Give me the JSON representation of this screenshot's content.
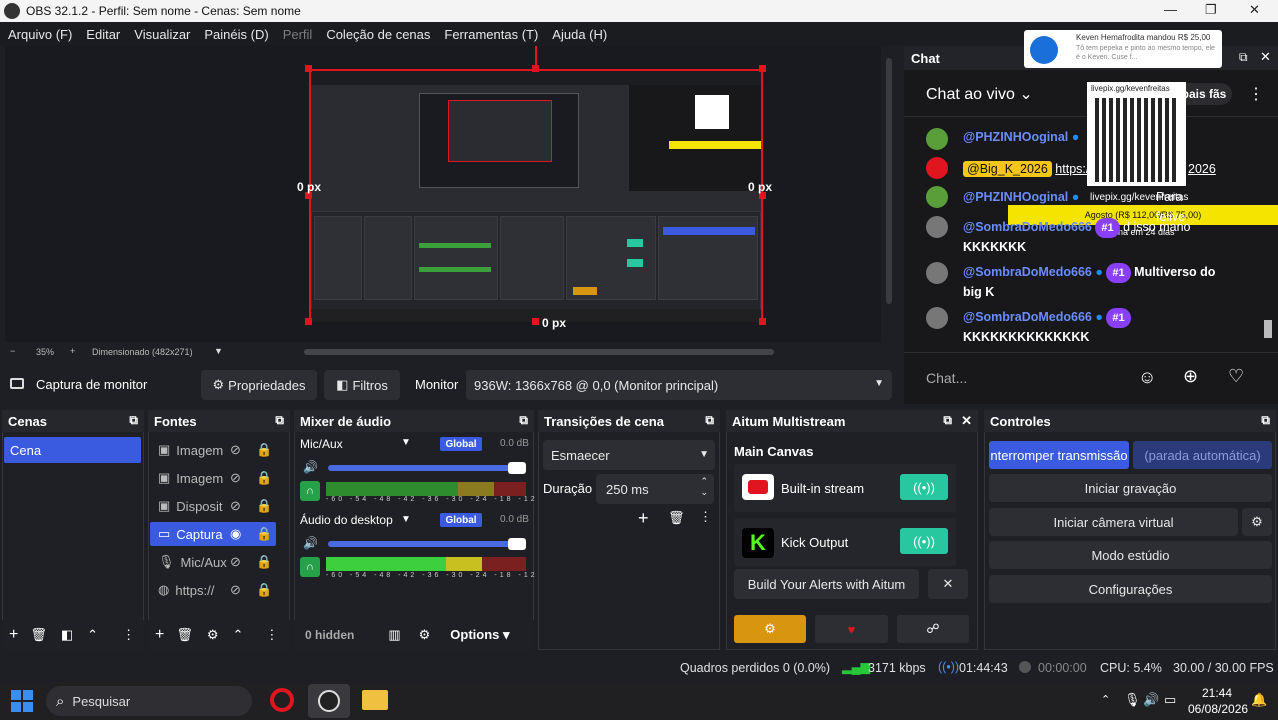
{
  "window": {
    "title": "OBS 32.1.2 - Perfil: Sem nome - Cenas: Sem nome",
    "minimize": "—",
    "maximize": "❐",
    "close": "✕"
  },
  "menu": [
    {
      "label": "Arquivo (F)"
    },
    {
      "label": "Editar"
    },
    {
      "label": "Visualizar"
    },
    {
      "label": "Painéis (D)"
    },
    {
      "label": "Perfil",
      "disabled": true
    },
    {
      "label": "Coleção de cenas"
    },
    {
      "label": "Ferramentas (T)"
    },
    {
      "label": "Ajuda (H)"
    }
  ],
  "preview": {
    "left_px": "0 px",
    "right_px": "0 px",
    "bottom_px": "0 px",
    "zoom_minus": "−",
    "zoom": "35%",
    "zoom_plus": "+",
    "scale_label": "Dimensionado (482x271)"
  },
  "source_toolbar": {
    "source_name": "Captura de monitor",
    "properties": "Propriedades",
    "filters": "Filtros",
    "monitor_label": "Monitor",
    "monitor_value": "936W: 1366x768 @ 0,0 (Monitor principal)"
  },
  "chat": {
    "title": "Chat",
    "live_label": "Chat ao vivo",
    "fans_label": "pais fãs",
    "input_placeholder": "Chat...",
    "donation": {
      "name": "Keven Hemafrodita",
      "action": "mandou",
      "amount": "R$ 25,00",
      "text": "Tô tem pepeka e pinto ao mesmo tempo, ele é o Keven. Cuse f..."
    },
    "livepix_url": "livepix.gg/kevenfreitas",
    "livepix_overlay": "livepix.gg/kevenfreitas",
    "goal": "Agosto (R$ 112,00/R$ 75,00)",
    "goal_end": "Termina em 24 dias",
    "messages": [
      {
        "user": "@PHZINHOoginal",
        "text": ""
      },
      {
        "user": "@Big_K_2026",
        "text": "https://",
        "extra": "2026",
        "highlight": true
      },
      {
        "user": "@PHZINHOoginal",
        "text": "Para felive"
      },
      {
        "user": "@SombraDoMedo666",
        "badge": "#1",
        "text": "d isso mano",
        "text2": "KKKKKKK"
      },
      {
        "user": "@SombraDoMedo666",
        "badge": "#1",
        "text": "Multiverso do",
        "text2": "big K"
      },
      {
        "user": "@SombraDoMedo666",
        "badge": "#1",
        "text": "",
        "text2": "KKKKKKKKKKKKKK"
      }
    ]
  },
  "docks": {
    "scenes": {
      "title": "Cenas",
      "items": [
        "Cena"
      ]
    },
    "sources": {
      "title": "Fontes",
      "items": [
        "Imagem",
        "Imagem",
        "Disposit",
        "Captura",
        "Mic/Aux",
        "https://"
      ]
    },
    "mixer": {
      "title": "Mixer de áudio",
      "tracks": [
        {
          "name": "Mic/Aux",
          "bus": "Global",
          "db": "0.0 dB"
        },
        {
          "name": "Áudio do desktop",
          "bus": "Global",
          "db": "0.0 dB"
        }
      ],
      "scale": "-60 -54 -48 -42 -36 -30 -24 -18 -12 -6 0",
      "hidden": "0 hidden",
      "options": "Options"
    },
    "transitions": {
      "title": "Transições de cena",
      "type": "Esmaecer",
      "duration_label": "Duração",
      "duration": "250 ms"
    },
    "multistream": {
      "title": "Aitum Multistream",
      "canvas": "Main Canvas",
      "outputs": [
        "Built-in stream",
        "Kick Output"
      ],
      "alerts": "Build Your Alerts with Aitum"
    },
    "controls": {
      "title": "Controles",
      "stop_stream": "nterromper transmissão",
      "auto_stop": "(parada automática)",
      "record": "Iniciar gravação",
      "virtual_cam": "Iniciar câmera virtual",
      "studio": "Modo estúdio",
      "settings": "Configurações"
    }
  },
  "status": {
    "dropped": "Quadros perdidos 0 (0.0%)",
    "bitrate": "3171 kbps",
    "stream_time": "01:44:43",
    "rec_time": "00:00:00",
    "cpu": "CPU: 5.4%",
    "fps": "30.00 / 30.00 FPS"
  },
  "taskbar": {
    "search": "Pesquisar",
    "time": "21:44",
    "date": "06/08/2026"
  },
  "colors": {
    "accent": "#3a5be0",
    "live_green": "#27c7a0",
    "red": "#e0151f",
    "yellow": "#f5e400",
    "purple": "#8a3ffc"
  }
}
